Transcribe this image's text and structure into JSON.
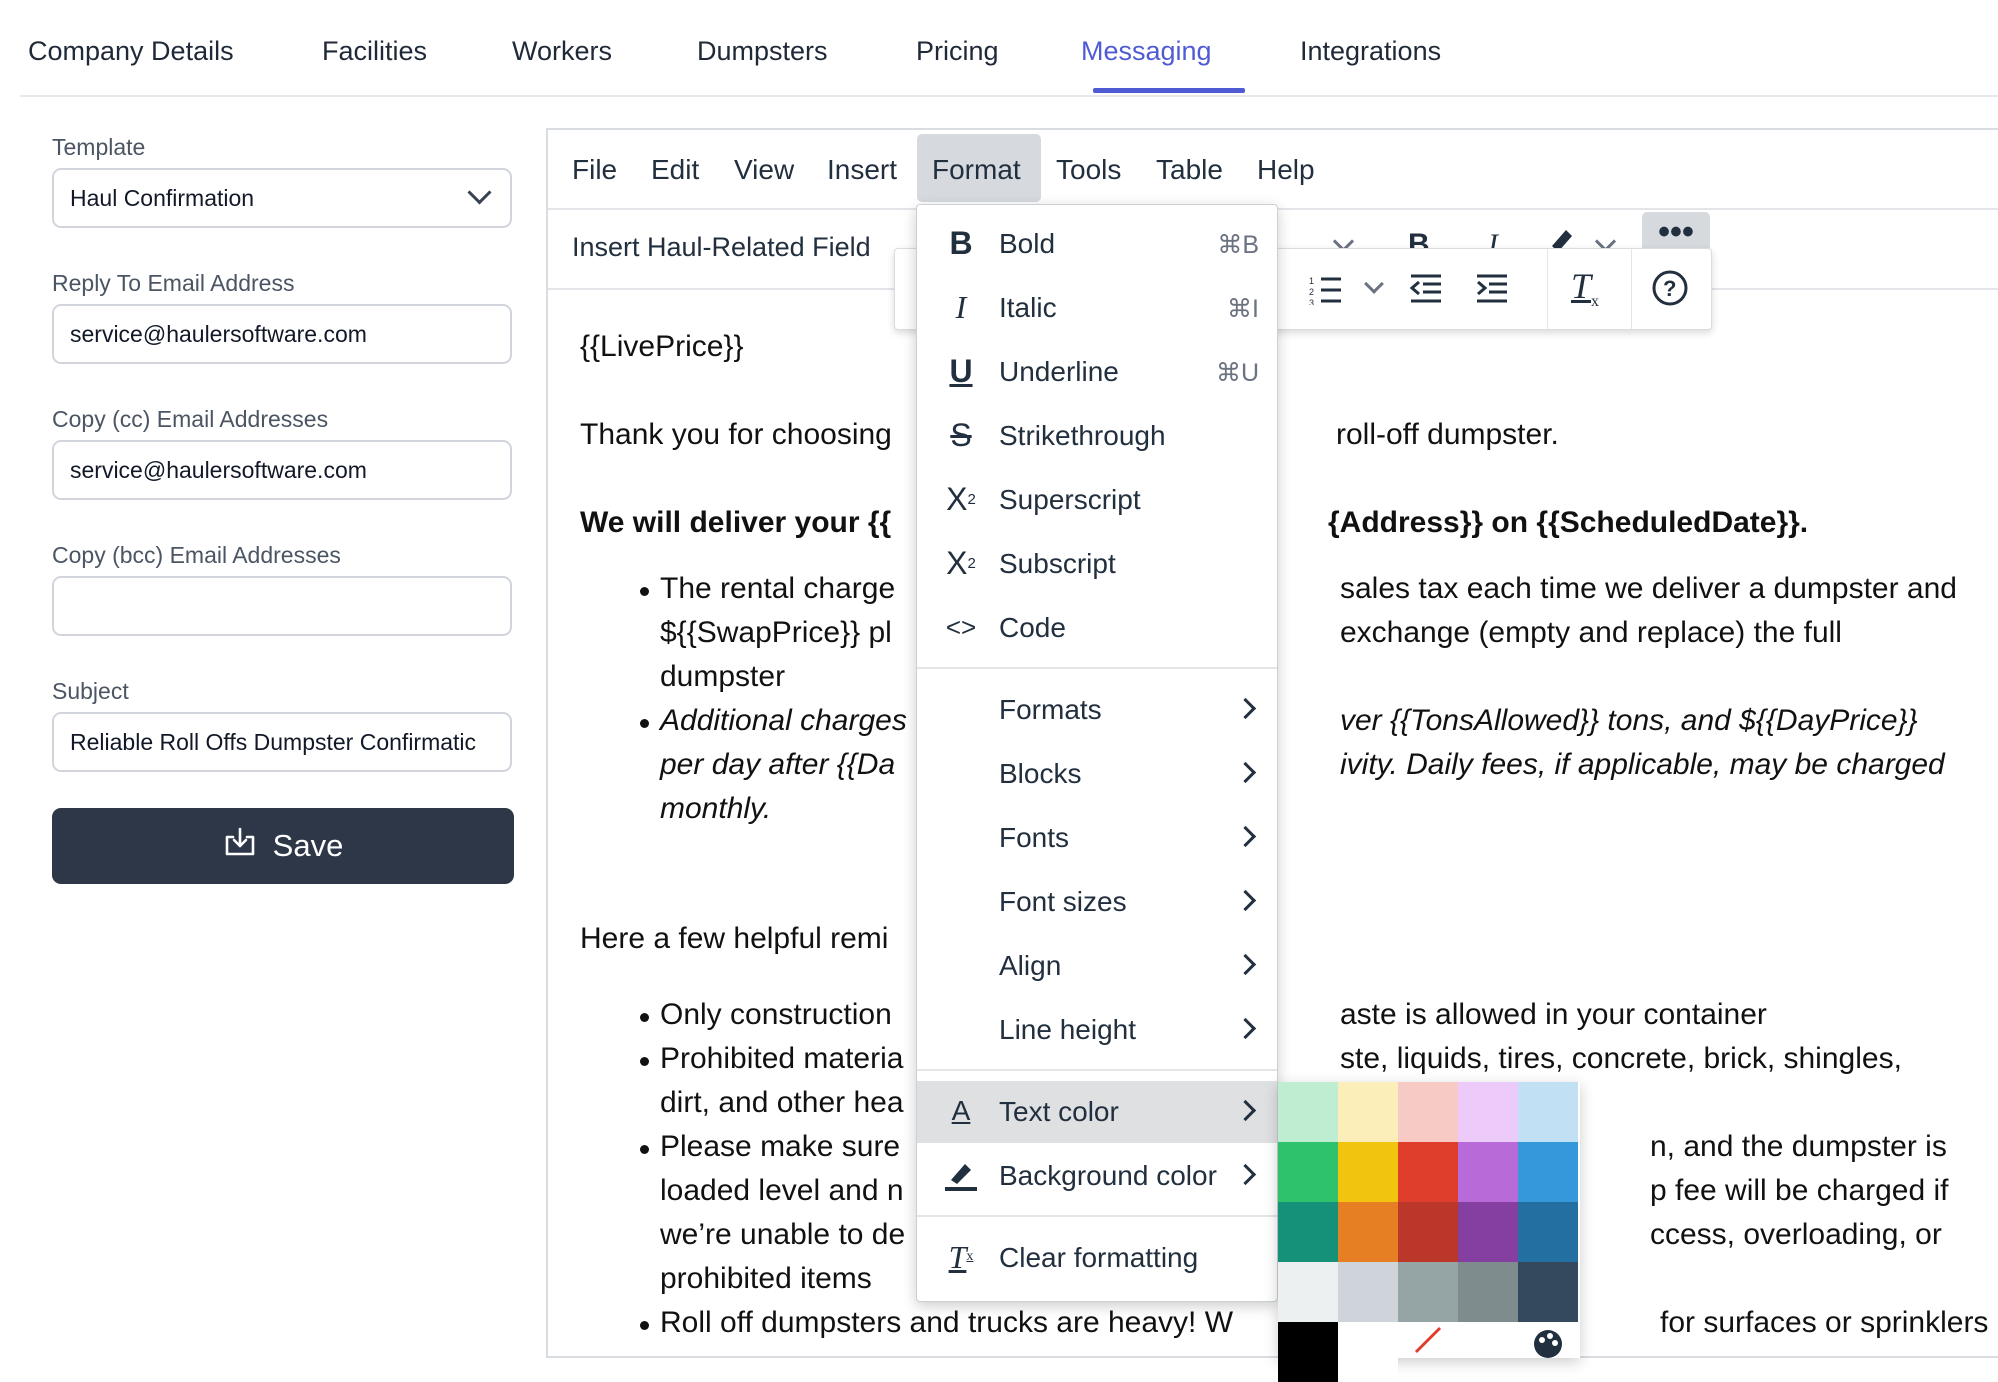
{
  "tabs": [
    {
      "label": "Company Details"
    },
    {
      "label": "Facilities"
    },
    {
      "label": "Workers"
    },
    {
      "label": "Dumpsters"
    },
    {
      "label": "Pricing"
    },
    {
      "label": "Messaging"
    },
    {
      "label": "Integrations"
    }
  ],
  "active_tab": "Messaging",
  "form": {
    "template_label": "Template",
    "template_value": "Haul Confirmation",
    "reply_to_label": "Reply To Email Address",
    "reply_to_value": "service@haulersoftware.com",
    "cc_label": "Copy (cc) Email Addresses",
    "cc_value": "service@haulersoftware.com",
    "bcc_label": "Copy (bcc) Email Addresses",
    "bcc_value": "",
    "subject_label": "Subject",
    "subject_value": "Reliable Roll Offs Dumpster Confirmatic",
    "save_label": "Save"
  },
  "editor": {
    "menus": [
      "File",
      "Edit",
      "View",
      "Insert",
      "Format",
      "Tools",
      "Table",
      "Help"
    ],
    "insert_field_label": "Insert Haul-Related Field",
    "content": {
      "line1": "{{LivePrice}}",
      "line2a": "Thank you for choosing",
      "line2b": "roll-off dumpster.",
      "line3a": "We will deliver your {{",
      "line3b": "{Address}} on {{ScheduledDate}}.",
      "b1a": "The rental charge",
      "b1b": "sales tax each time we deliver a dumpster and",
      "b1c": "${{SwapPrice}} pl",
      "b1d": "exchange (empty and replace) the full",
      "b1e": "dumpster",
      "b2a": "Additional charges",
      "b2b": "ver {{TonsAllowed}} tons, and ${{DayPrice}}",
      "b2c": "per day after {{Da",
      "b2d": "ivity. Daily fees, if applicable, may be charged",
      "b2e": "monthly.",
      "line4": "Here a few helpful remi",
      "c1a": "Only construction",
      "c1b": "aste is allowed in your container",
      "c2a": "Prohibited materia",
      "c2b": "ste, liquids, tires, concrete, brick, shingles,",
      "c2c": "dirt, and other hea",
      "c3a": "Please make sure",
      "c3b": "n, and the dumpster is",
      "c3c": "loaded level and n",
      "c3d": "p fee will be charged if",
      "c3e": "we’re unable to de",
      "c3f": "ccess, overloading, or",
      "c3g": "prohibited items",
      "c4a": "Roll off dumpsters and trucks are heavy! W",
      "c4b": "for surfaces or sprinklers"
    }
  },
  "format_menu": {
    "items": [
      {
        "label": "Bold",
        "shortcut": "⌘B"
      },
      {
        "label": "Italic",
        "shortcut": "⌘I"
      },
      {
        "label": "Underline",
        "shortcut": "⌘U"
      },
      {
        "label": "Strikethrough"
      },
      {
        "label": "Superscript"
      },
      {
        "label": "Subscript"
      },
      {
        "label": "Code"
      },
      {
        "label": "Formats"
      },
      {
        "label": "Blocks"
      },
      {
        "label": "Fonts"
      },
      {
        "label": "Font sizes"
      },
      {
        "label": "Align"
      },
      {
        "label": "Line height"
      },
      {
        "label": "Text color"
      },
      {
        "label": "Background color"
      },
      {
        "label": "Clear formatting"
      }
    ]
  },
  "colors": {
    "accent": "#4f5bd5",
    "save_button": "#2d3748",
    "swatches": [
      "#bfedd2",
      "#fbeeb8",
      "#f8cac6",
      "#eccafa",
      "#c2e0f4",
      "#2dc26b",
      "#f1c40f",
      "#e03e2d",
      "#b96ad9",
      "#3598db",
      "#169179",
      "#e67e23",
      "#ba372a",
      "#843fa1",
      "#236fa1",
      "#ecf0f1",
      "#ced4d9",
      "#95a5a6",
      "#7e8c8d",
      "#34495e",
      "#000000",
      "#ffffff"
    ]
  }
}
